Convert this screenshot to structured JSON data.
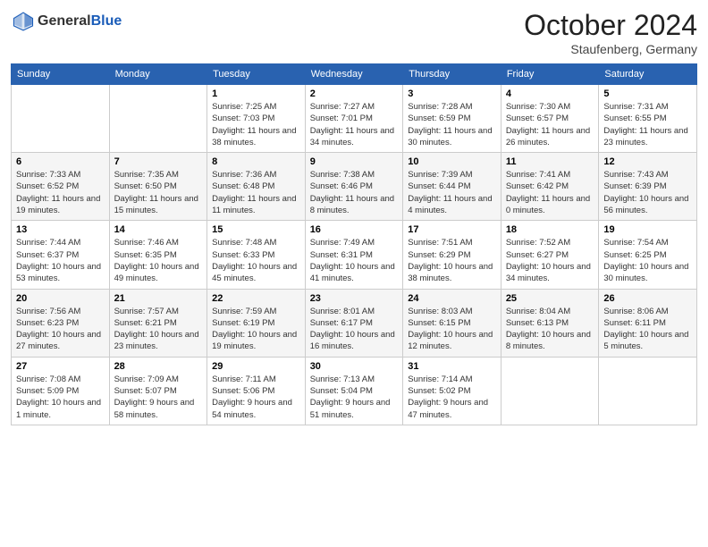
{
  "header": {
    "logo_general": "General",
    "logo_blue": "Blue",
    "month": "October 2024",
    "location": "Staufenberg, Germany"
  },
  "days_of_week": [
    "Sunday",
    "Monday",
    "Tuesday",
    "Wednesday",
    "Thursday",
    "Friday",
    "Saturday"
  ],
  "weeks": [
    [
      {
        "day": "",
        "info": ""
      },
      {
        "day": "",
        "info": ""
      },
      {
        "day": "1",
        "info": "Sunrise: 7:25 AM\nSunset: 7:03 PM\nDaylight: 11 hours and 38 minutes."
      },
      {
        "day": "2",
        "info": "Sunrise: 7:27 AM\nSunset: 7:01 PM\nDaylight: 11 hours and 34 minutes."
      },
      {
        "day": "3",
        "info": "Sunrise: 7:28 AM\nSunset: 6:59 PM\nDaylight: 11 hours and 30 minutes."
      },
      {
        "day": "4",
        "info": "Sunrise: 7:30 AM\nSunset: 6:57 PM\nDaylight: 11 hours and 26 minutes."
      },
      {
        "day": "5",
        "info": "Sunrise: 7:31 AM\nSunset: 6:55 PM\nDaylight: 11 hours and 23 minutes."
      }
    ],
    [
      {
        "day": "6",
        "info": "Sunrise: 7:33 AM\nSunset: 6:52 PM\nDaylight: 11 hours and 19 minutes."
      },
      {
        "day": "7",
        "info": "Sunrise: 7:35 AM\nSunset: 6:50 PM\nDaylight: 11 hours and 15 minutes."
      },
      {
        "day": "8",
        "info": "Sunrise: 7:36 AM\nSunset: 6:48 PM\nDaylight: 11 hours and 11 minutes."
      },
      {
        "day": "9",
        "info": "Sunrise: 7:38 AM\nSunset: 6:46 PM\nDaylight: 11 hours and 8 minutes."
      },
      {
        "day": "10",
        "info": "Sunrise: 7:39 AM\nSunset: 6:44 PM\nDaylight: 11 hours and 4 minutes."
      },
      {
        "day": "11",
        "info": "Sunrise: 7:41 AM\nSunset: 6:42 PM\nDaylight: 11 hours and 0 minutes."
      },
      {
        "day": "12",
        "info": "Sunrise: 7:43 AM\nSunset: 6:39 PM\nDaylight: 10 hours and 56 minutes."
      }
    ],
    [
      {
        "day": "13",
        "info": "Sunrise: 7:44 AM\nSunset: 6:37 PM\nDaylight: 10 hours and 53 minutes."
      },
      {
        "day": "14",
        "info": "Sunrise: 7:46 AM\nSunset: 6:35 PM\nDaylight: 10 hours and 49 minutes."
      },
      {
        "day": "15",
        "info": "Sunrise: 7:48 AM\nSunset: 6:33 PM\nDaylight: 10 hours and 45 minutes."
      },
      {
        "day": "16",
        "info": "Sunrise: 7:49 AM\nSunset: 6:31 PM\nDaylight: 10 hours and 41 minutes."
      },
      {
        "day": "17",
        "info": "Sunrise: 7:51 AM\nSunset: 6:29 PM\nDaylight: 10 hours and 38 minutes."
      },
      {
        "day": "18",
        "info": "Sunrise: 7:52 AM\nSunset: 6:27 PM\nDaylight: 10 hours and 34 minutes."
      },
      {
        "day": "19",
        "info": "Sunrise: 7:54 AM\nSunset: 6:25 PM\nDaylight: 10 hours and 30 minutes."
      }
    ],
    [
      {
        "day": "20",
        "info": "Sunrise: 7:56 AM\nSunset: 6:23 PM\nDaylight: 10 hours and 27 minutes."
      },
      {
        "day": "21",
        "info": "Sunrise: 7:57 AM\nSunset: 6:21 PM\nDaylight: 10 hours and 23 minutes."
      },
      {
        "day": "22",
        "info": "Sunrise: 7:59 AM\nSunset: 6:19 PM\nDaylight: 10 hours and 19 minutes."
      },
      {
        "day": "23",
        "info": "Sunrise: 8:01 AM\nSunset: 6:17 PM\nDaylight: 10 hours and 16 minutes."
      },
      {
        "day": "24",
        "info": "Sunrise: 8:03 AM\nSunset: 6:15 PM\nDaylight: 10 hours and 12 minutes."
      },
      {
        "day": "25",
        "info": "Sunrise: 8:04 AM\nSunset: 6:13 PM\nDaylight: 10 hours and 8 minutes."
      },
      {
        "day": "26",
        "info": "Sunrise: 8:06 AM\nSunset: 6:11 PM\nDaylight: 10 hours and 5 minutes."
      }
    ],
    [
      {
        "day": "27",
        "info": "Sunrise: 7:08 AM\nSunset: 5:09 PM\nDaylight: 10 hours and 1 minute."
      },
      {
        "day": "28",
        "info": "Sunrise: 7:09 AM\nSunset: 5:07 PM\nDaylight: 9 hours and 58 minutes."
      },
      {
        "day": "29",
        "info": "Sunrise: 7:11 AM\nSunset: 5:06 PM\nDaylight: 9 hours and 54 minutes."
      },
      {
        "day": "30",
        "info": "Sunrise: 7:13 AM\nSunset: 5:04 PM\nDaylight: 9 hours and 51 minutes."
      },
      {
        "day": "31",
        "info": "Sunrise: 7:14 AM\nSunset: 5:02 PM\nDaylight: 9 hours and 47 minutes."
      },
      {
        "day": "",
        "info": ""
      },
      {
        "day": "",
        "info": ""
      }
    ]
  ]
}
